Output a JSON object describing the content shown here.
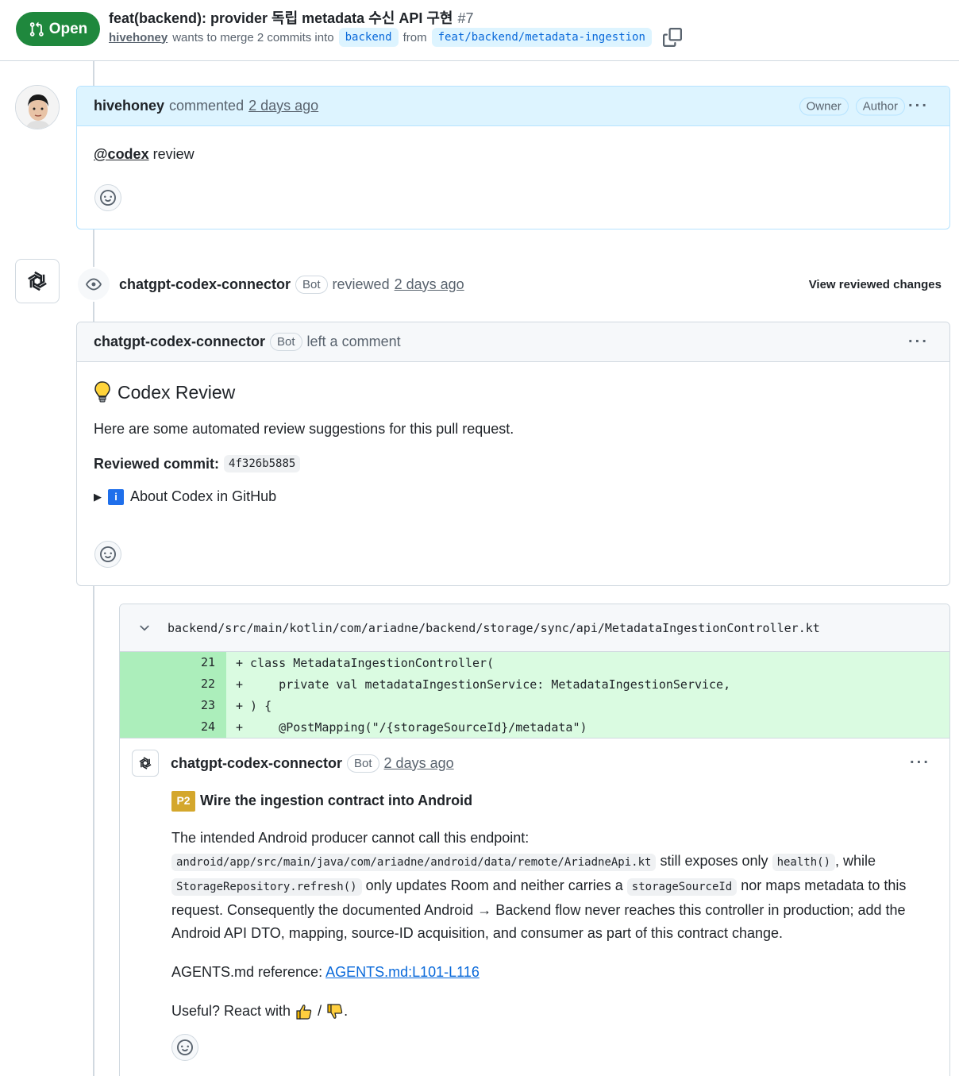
{
  "header": {
    "state": "Open",
    "title": "feat(backend): provider 독립 metadata 수신 API 구현",
    "number": "#7",
    "author": "hivehoney",
    "meta_text": "wants to merge 2 commits into",
    "base_branch": "backend",
    "from_text": "from",
    "head_branch": "feat/backend/metadata-ingestion"
  },
  "comment1": {
    "author": "hivehoney",
    "action": "commented",
    "time": "2 days ago",
    "badges": [
      "Owner",
      "Author"
    ],
    "mention": "@codex",
    "body": "review"
  },
  "review": {
    "author": "chatgpt-codex-connector",
    "bot_badge": "Bot",
    "action": "reviewed",
    "time": "2 days ago",
    "view_changes": "View reviewed changes"
  },
  "comment2": {
    "author": "chatgpt-codex-connector",
    "bot_badge": "Bot",
    "action": "left a comment",
    "heading": "Codex Review",
    "intro": "Here are some automated review suggestions for this pull request.",
    "reviewed_label": "Reviewed commit:",
    "commit": "4f326b5885",
    "about": "About Codex in GitHub"
  },
  "diff": {
    "path": "backend/src/main/kotlin/com/ariadne/backend/storage/sync/api/MetadataIngestionController.kt",
    "lines": [
      {
        "num": "21",
        "code": "+ class MetadataIngestionController("
      },
      {
        "num": "22",
        "code": "+     private val metadataIngestionService: MetadataIngestionService,"
      },
      {
        "num": "23",
        "code": "+ ) {"
      },
      {
        "num": "24",
        "code": "+     @PostMapping(\"/{storageSourceId}/metadata\")"
      }
    ]
  },
  "inline_comment": {
    "author": "chatgpt-codex-connector",
    "bot_badge": "Bot",
    "time": "2 days ago",
    "priority": "P2",
    "title": "Wire the ingestion contract into Android",
    "p1": "The intended Android producer cannot call this endpoint:",
    "code1": "android/app/src/main/java/com/ariadne/android/data/remote/AriadneApi.kt",
    "t1": "still exposes only",
    "code2": "health()",
    "t2": ", while",
    "code3": "StorageRepository.refresh()",
    "t3": "only updates Room and neither carries a",
    "code4": "storageSourceId",
    "t4": "nor maps metadata to this request. Consequently the documented Android → Backend flow never reaches this controller in production; add the Android API DTO, mapping, source-ID acquisition, and consumer as part of this contract change.",
    "ref_label": "AGENTS.md reference:",
    "ref_link": "AGENTS.md:L101-L116",
    "useful": "Useful? React with",
    "useful_sep": "/",
    "useful_end": "."
  }
}
